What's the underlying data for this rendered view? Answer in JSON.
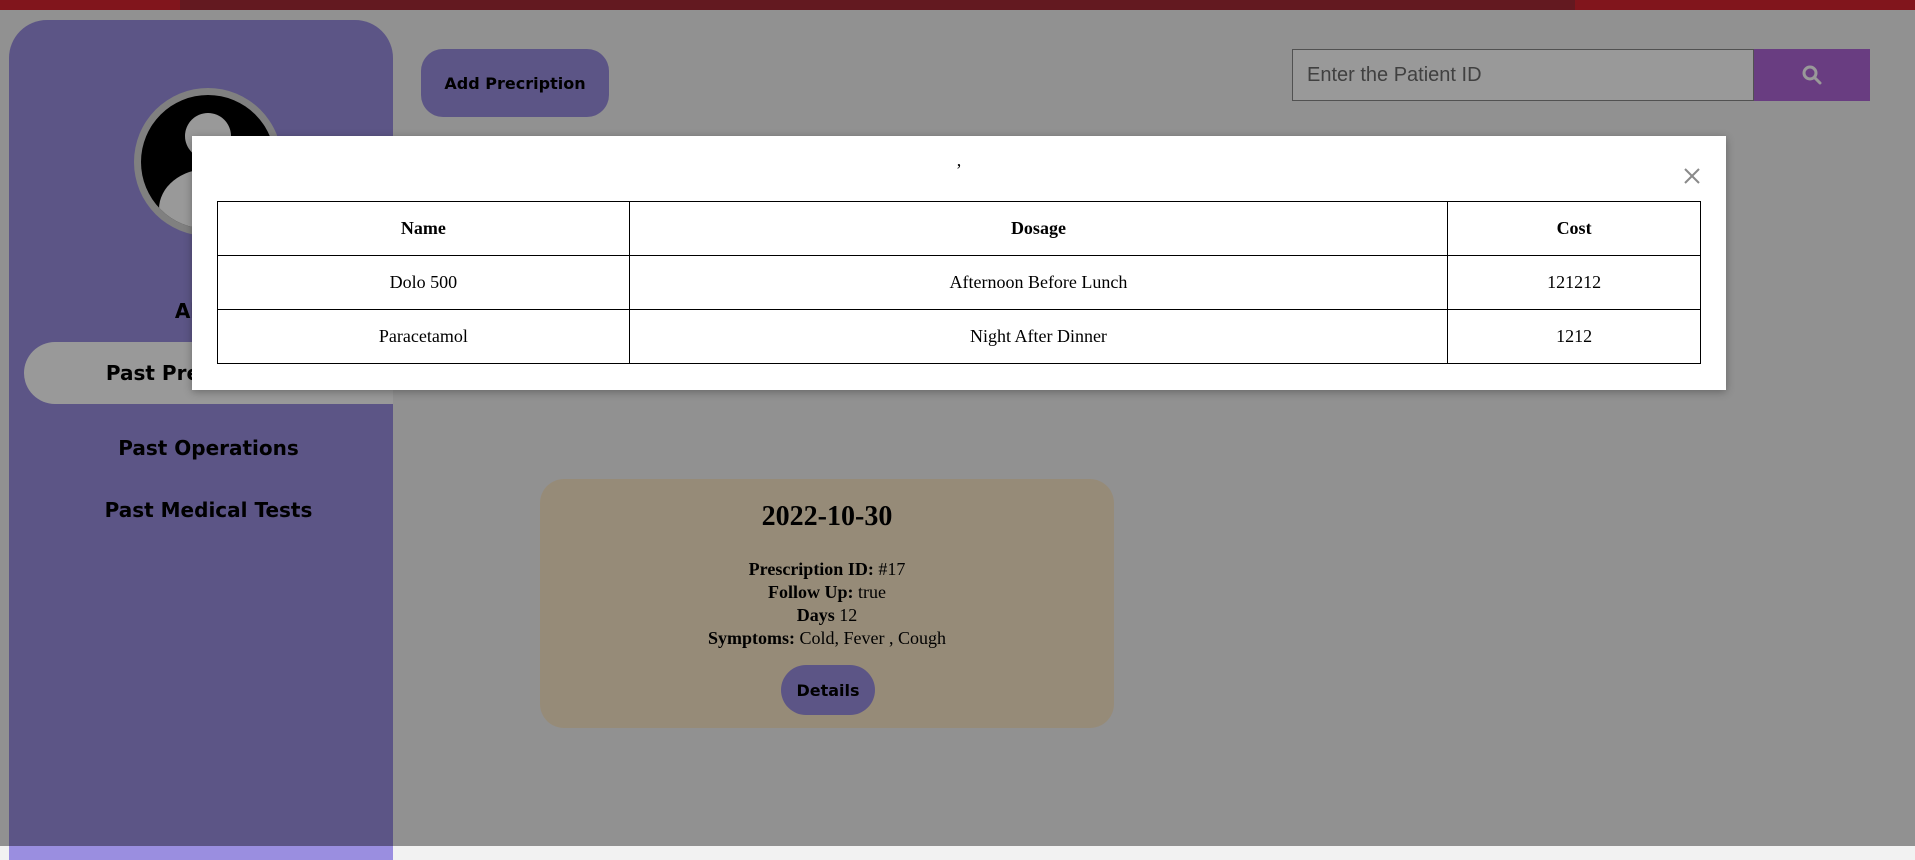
{
  "toolbar": {
    "add_label": "Add Precription",
    "search_placeholder": "Enter the Patient ID"
  },
  "sidebar": {
    "items": [
      {
        "label": "About"
      },
      {
        "label": "Past Prescriptions"
      },
      {
        "label": "Past Operations"
      },
      {
        "label": "Past Medical Tests"
      }
    ]
  },
  "card": {
    "date": "2022-10-30",
    "prescription_id_label": "Prescription ID:",
    "prescription_id": "#17",
    "follow_up_label": "Follow Up:",
    "follow_up": "true",
    "days_label": "Days",
    "days": "12",
    "symptoms_label": "Symptoms:",
    "symptoms": "Cold, Fever , Cough",
    "details_label": "Details"
  },
  "modal": {
    "title": ",",
    "headers": [
      "Name",
      "Dosage",
      "Cost"
    ],
    "rows": [
      [
        "Dolo 500",
        "Afternoon Before Lunch",
        "121212"
      ],
      [
        "Paracetamol",
        "Night After Dinner",
        "1212"
      ]
    ]
  },
  "colors": {
    "sidebar": "#9a8ee0",
    "search_button": "#b066d8",
    "card": "#fbe8c9",
    "top_bar": "#d8232f"
  }
}
